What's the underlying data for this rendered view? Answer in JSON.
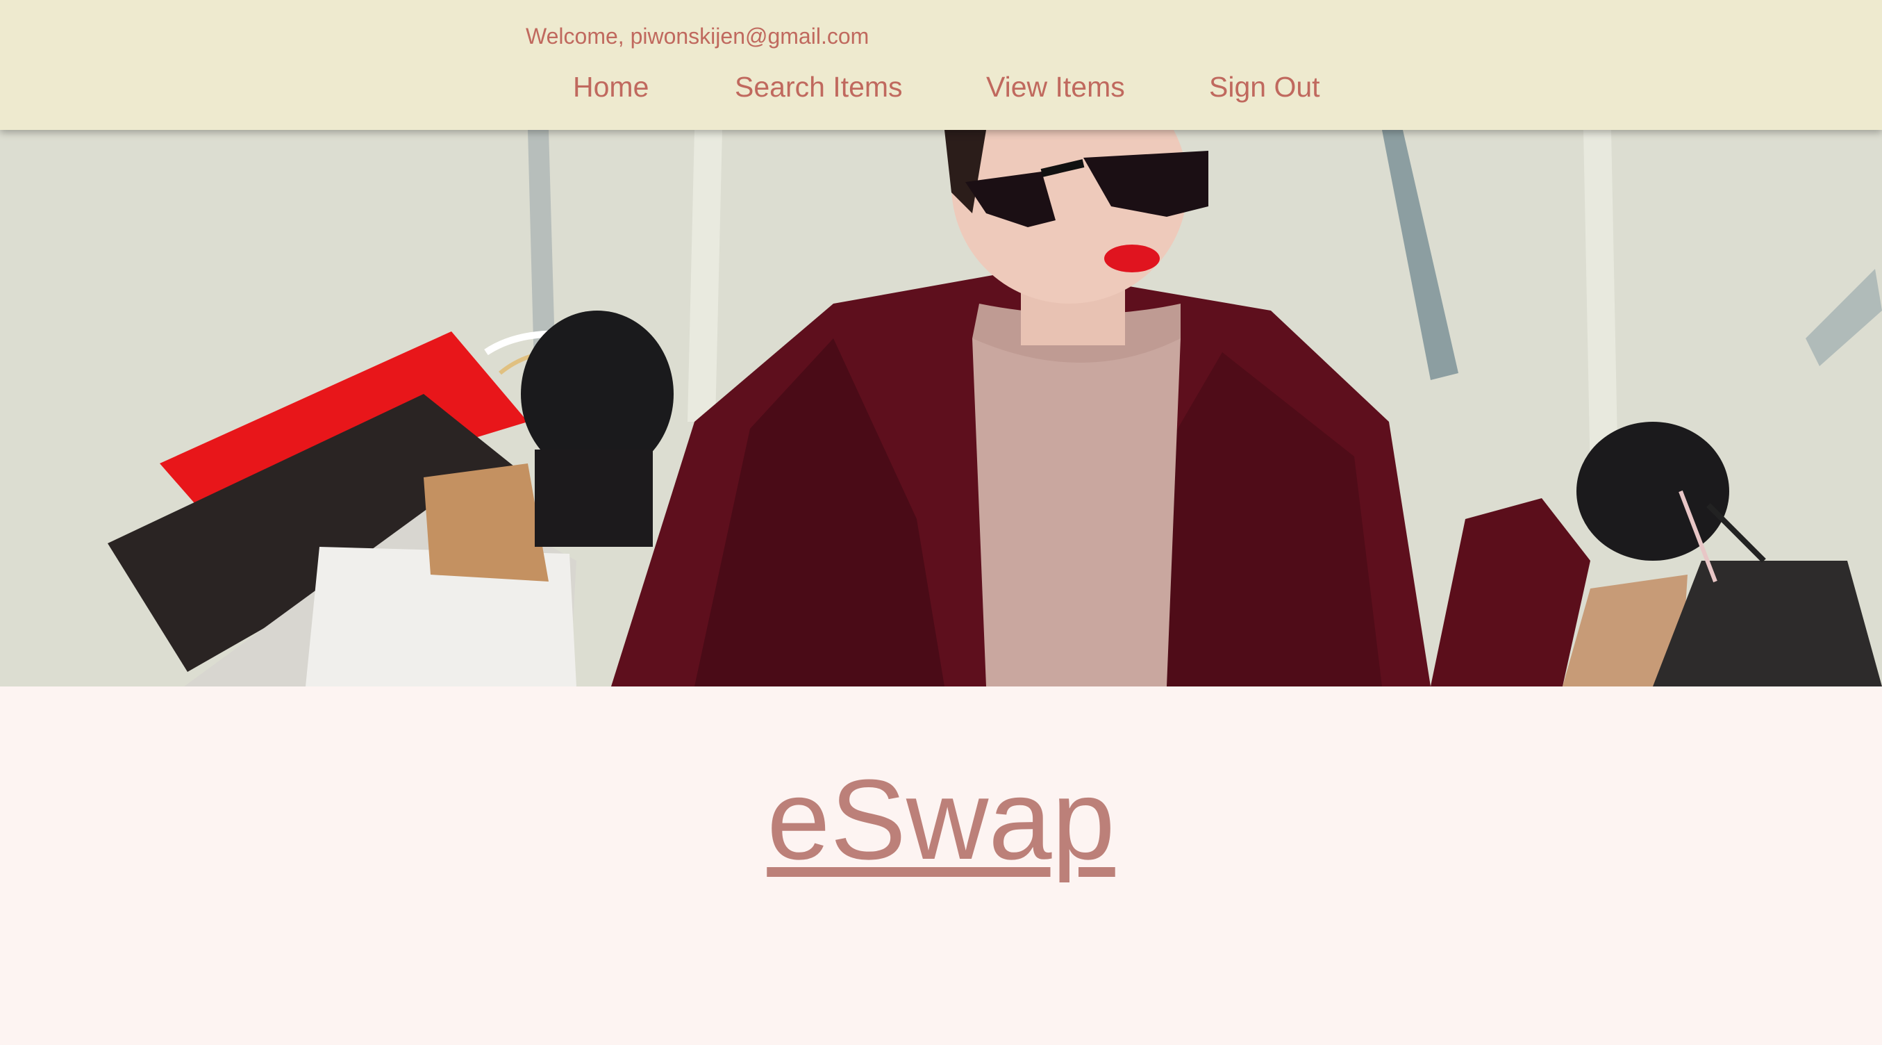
{
  "header": {
    "welcome_text": "Welcome, piwonskijen@gmail.com",
    "nav": {
      "home": "Home",
      "search_items": "Search Items",
      "view_items": "View Items",
      "sign_out": "Sign Out"
    }
  },
  "hero": {
    "image": "hero-photo-woman-with-shopping-bags"
  },
  "brand": {
    "title": "eSwap"
  },
  "colors": {
    "header_bg": "#eeeacf",
    "nav_text": "#c0695e",
    "page_bg": "#fdf4f2",
    "brand_text": "#bc8079"
  }
}
